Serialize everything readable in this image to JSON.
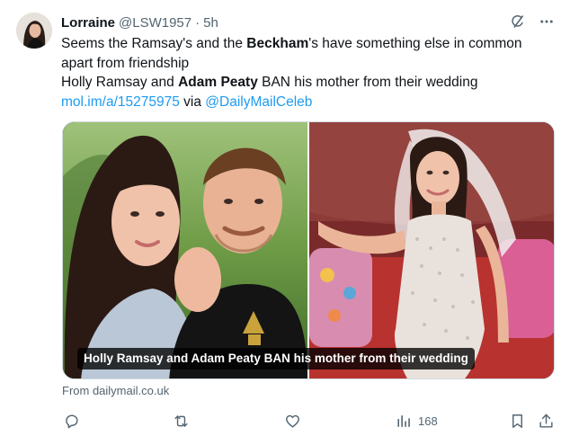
{
  "tweet": {
    "author": {
      "display_name": "Lorraine",
      "handle": "@LSW1957",
      "separator": "·",
      "time": "5h"
    },
    "text": {
      "line1_pre": "Seems the Ramsay's and the ",
      "line1_bold": "Beckham",
      "line1_post": "'s have something else in common",
      "line2": "apart from friendship",
      "line3_pre": "Holly Ramsay and ",
      "line3_bold": "Adam Peaty",
      "line3_post": " BAN his mother from their wedding",
      "link_url": "mol.im/a/15275975",
      "via_label": " via ",
      "link_mention": "@DailyMailCeleb"
    },
    "media": {
      "caption": "Holly Ramsay and Adam Peaty BAN his mother from their wedding"
    },
    "source": "From dailymail.co.uk",
    "actions": {
      "reply_icon": "reply-icon",
      "retweet_icon": "retweet-icon",
      "like_icon": "like-icon",
      "views_icon": "views-icon",
      "views_count": "168",
      "bookmark_icon": "bookmark-icon",
      "share_icon": "share-icon"
    },
    "top_icons": [
      "grok-icon",
      "more-icon"
    ]
  },
  "colors": {
    "text": "#0f1419",
    "muted": "#536471",
    "link": "#1d9bf0",
    "border": "#cfd9de"
  }
}
